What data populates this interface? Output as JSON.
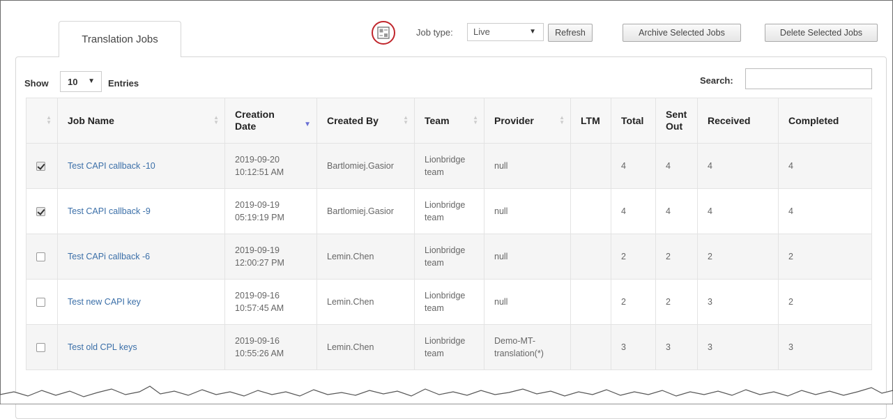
{
  "tabs": {
    "translation_jobs": "Translation Jobs"
  },
  "toolbar": {
    "icon": "layout-toggle-icon",
    "job_type_label": "Job type:",
    "job_type_value": "Live",
    "refresh_label": "Refresh",
    "archive_label": "Archive Selected Jobs",
    "delete_label": "Delete Selected Jobs"
  },
  "controls": {
    "show_label": "Show",
    "entries_value": "10",
    "entries_label": "Entries",
    "search_label": "Search:",
    "search_value": ""
  },
  "table": {
    "columns": {
      "select": "",
      "job_name": "Job Name",
      "creation_date_1": "Creation",
      "creation_date_2": "Date",
      "created_by": "Created By",
      "team": "Team",
      "provider": "Provider",
      "ltm": "LTM",
      "total": "Total",
      "sent_out_1": "Sent",
      "sent_out_2": "Out",
      "received": "Received",
      "completed": "Completed"
    },
    "rows": [
      {
        "checked": true,
        "job_name": "Test CAPI callback -10",
        "date": "2019-09-20",
        "time": "10:12:51 AM",
        "created_by": "Bartlomiej.Gasior",
        "team_1": "Lionbridge",
        "team_2": "team",
        "provider_1": "null",
        "provider_2": "",
        "ltm": "",
        "total": "4",
        "sent_out": "4",
        "received": "4",
        "completed": "4"
      },
      {
        "checked": true,
        "job_name": "Test CAPI callback -9",
        "date": "2019-09-19",
        "time": "05:19:19 PM",
        "created_by": "Bartlomiej.Gasior",
        "team_1": "Lionbridge",
        "team_2": "team",
        "provider_1": "null",
        "provider_2": "",
        "ltm": "",
        "total": "4",
        "sent_out": "4",
        "received": "4",
        "completed": "4"
      },
      {
        "checked": false,
        "job_name": "Test CAPi callback -6",
        "date": "2019-09-19",
        "time": "12:00:27 PM",
        "created_by": "Lemin.Chen",
        "team_1": "Lionbridge",
        "team_2": "team",
        "provider_1": "null",
        "provider_2": "",
        "ltm": "",
        "total": "2",
        "sent_out": "2",
        "received": "2",
        "completed": "2"
      },
      {
        "checked": false,
        "job_name": "Test new CAPI key",
        "date": "2019-09-16",
        "time": "10:57:45 AM",
        "created_by": "Lemin.Chen",
        "team_1": "Lionbridge",
        "team_2": "team",
        "provider_1": "null",
        "provider_2": "",
        "ltm": "",
        "total": "2",
        "sent_out": "2",
        "received": "3",
        "completed": "2"
      },
      {
        "checked": false,
        "job_name": "Test old CPL keys",
        "date": "2019-09-16",
        "time": "10:55:26 AM",
        "created_by": "Lemin.Chen",
        "team_1": "Lionbridge",
        "team_2": "team",
        "provider_1": "Demo-MT-",
        "provider_2": "translation(*)",
        "ltm": "",
        "total": "3",
        "sent_out": "3",
        "received": "3",
        "completed": "3"
      }
    ]
  },
  "colors": {
    "link": "#3b6fa8",
    "highlight_circle": "#c0262c",
    "sort_active": "#6a6fd4"
  }
}
